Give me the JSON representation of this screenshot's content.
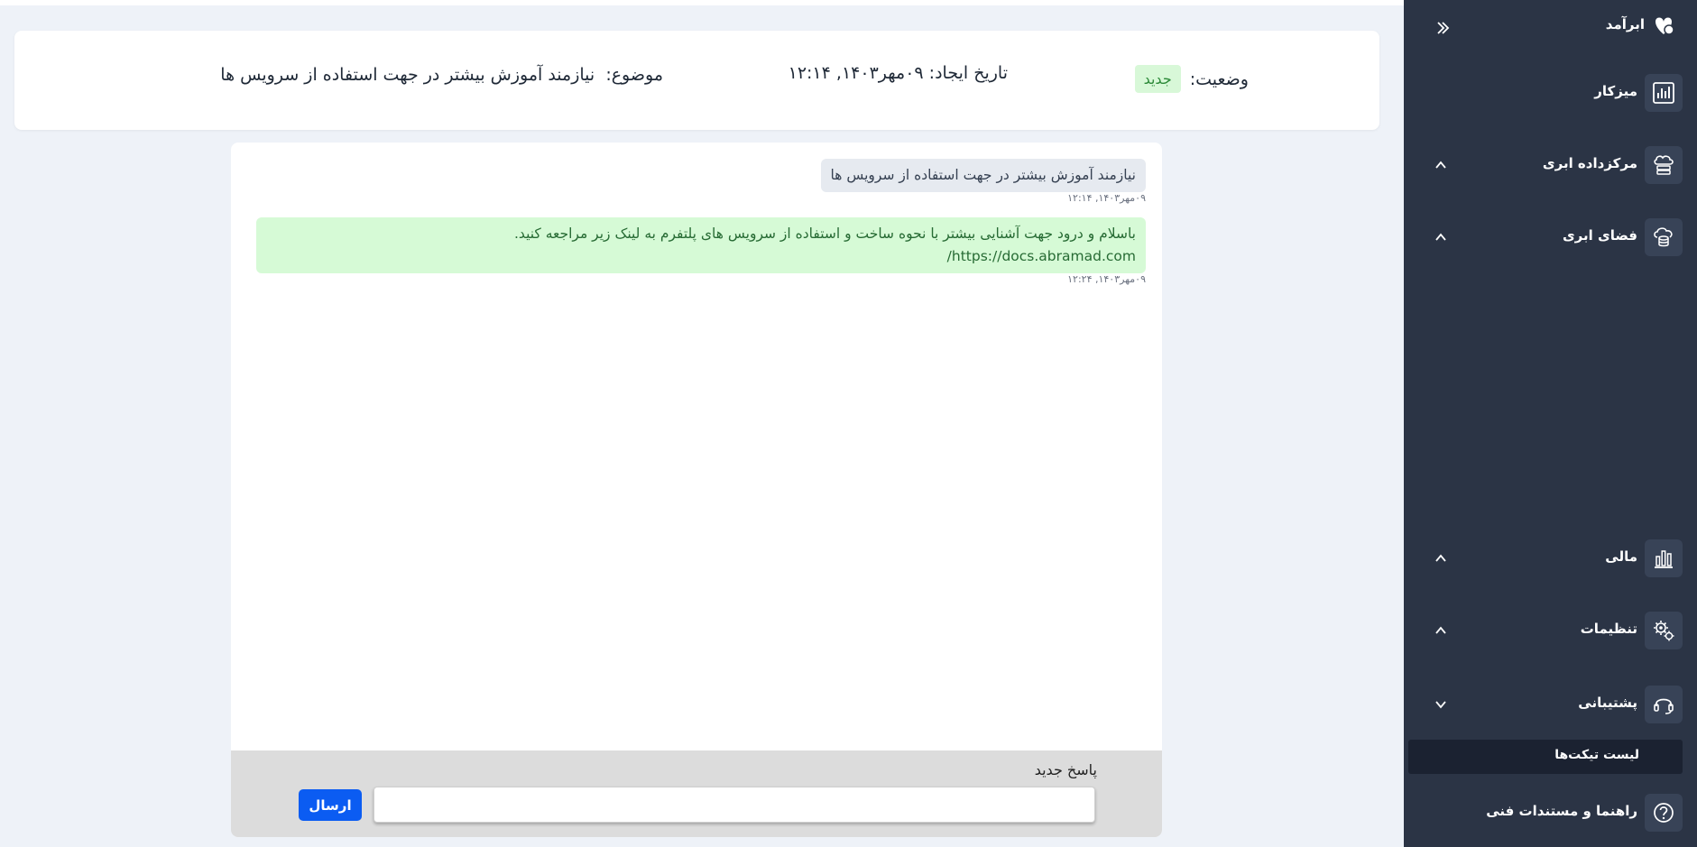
{
  "sidebar": {
    "brand": "ابرآمد",
    "items": [
      {
        "label": "میزکار",
        "icon": "dashboard-chart-icon",
        "chevron": "none"
      },
      {
        "label": "مرکزداده ابری",
        "icon": "cloud-server-icon",
        "chevron": "up"
      },
      {
        "label": "فضای ابری",
        "icon": "cloud-storage-icon",
        "chevron": "up"
      },
      {
        "label": "مالی",
        "icon": "bar-chart-icon",
        "chevron": "up"
      },
      {
        "label": "تنظیمات",
        "icon": "gears-icon",
        "chevron": "up"
      },
      {
        "label": "پشتیبانی",
        "icon": "headset-icon",
        "chevron": "down"
      },
      {
        "label": "راهنما و مستندات فنی",
        "icon": "help-circle-icon",
        "chevron": "none"
      }
    ],
    "subitem": "لیست تیکت‌ها"
  },
  "ticket": {
    "status_label": "وضعیت:",
    "status_value": "جدید",
    "date_label": "تاریخ ایجاد:",
    "date_value": "۰۹مهر۱۴۰۳, ۱۲:۱۴",
    "subject_label": "موضوع:",
    "subject_value": "نیازمند آموزش بیشتر در جهت استفاده از سرویس ها"
  },
  "messages": [
    {
      "text": "نیازمند آموزش بیشتر در جهت استفاده از سرویس ها",
      "time": "۰۹مهر۱۴۰۳, ۱۲:۱۴"
    },
    {
      "line1": "باسلام و درود  جهت آشنایی بیشتر با نحوه ساخت و استفاده از سرویس های پلتفرم به لینک زیر مراجعه کنید.",
      "line2": "https://docs.abramad.com/",
      "time": "۰۹مهر۱۴۰۳, ۱۲:۲۴"
    }
  ],
  "composer": {
    "label": "پاسخ جدید",
    "value": "",
    "send_label": "ارسال"
  },
  "colors": {
    "sidebar_bg": "#2b3445",
    "badge_bg": "#d8f8d8",
    "support_msg_bg": "#d6fad6",
    "send_button": "#0b5cf2"
  }
}
